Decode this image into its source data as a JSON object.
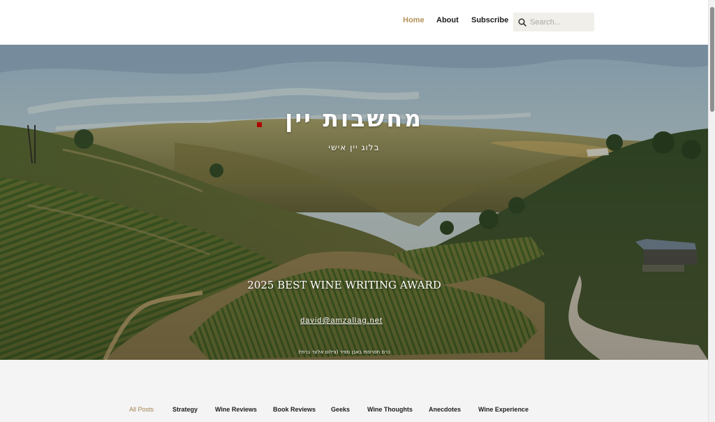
{
  "header": {
    "nav": [
      {
        "label": "Home",
        "active": true
      },
      {
        "label": "About",
        "active": false
      },
      {
        "label": "Subscribe",
        "active": false
      }
    ],
    "search": {
      "placeholder": "Search..."
    },
    "colors": {
      "active_nav": "#b6935a",
      "search_bg": "#f1efe9"
    }
  },
  "hero": {
    "title": "מחשבות יין",
    "subtitle": "בלוג יין אישי",
    "award": "2025 BEST WINE WRITING AWARD",
    "email": "david@amzallag.net",
    "caption": "כרם חסרפות באבן ספיר (צילום אלעד ברמי)"
  },
  "categories": [
    {
      "label": "All Posts",
      "active": true
    },
    {
      "label": "Strategy",
      "active": false
    },
    {
      "label": "Wine Reviews",
      "active": false
    },
    {
      "label": "Book Reviews",
      "active": false
    },
    {
      "label": "Geeks",
      "active": false
    },
    {
      "label": "Wine Thoughts",
      "active": false
    },
    {
      "label": "Anecdotes",
      "active": false
    },
    {
      "label": "Wine Experience",
      "active": false
    }
  ]
}
